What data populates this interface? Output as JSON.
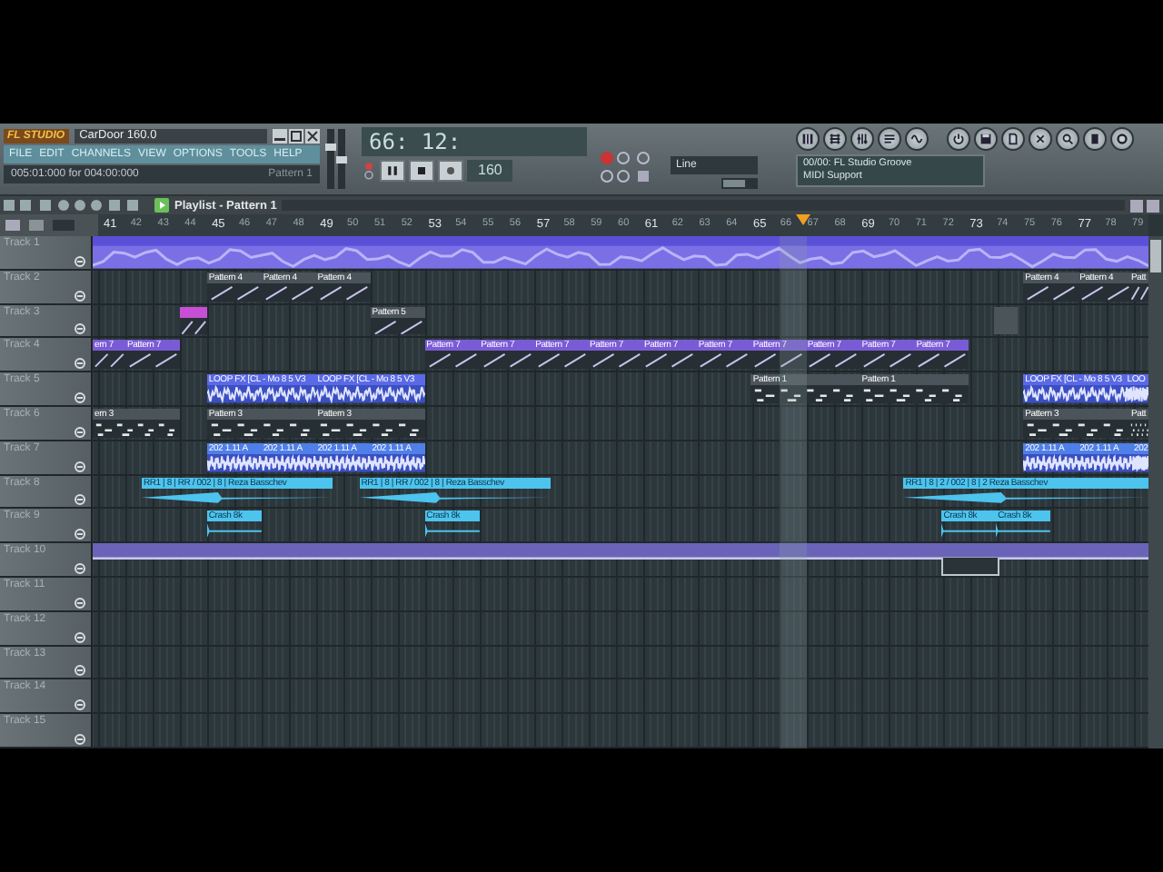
{
  "app": {
    "logo": "FL STUDIO",
    "title": "CarDoor 160.0",
    "menu": [
      "FILE",
      "EDIT",
      "CHANNELS",
      "VIEW",
      "OPTIONS",
      "TOOLS",
      "HELP"
    ],
    "hint": "005:01:000 for 004:00:000",
    "hint_pattern": "Pattern 1"
  },
  "transport": {
    "time": "66: 12:",
    "tempo": "160",
    "input": "Line",
    "volume": {
      "level": 0.75
    },
    "pitch": {
      "level": 0.5
    }
  },
  "midi": {
    "line1": "00/00: FL Studio Groove",
    "line2": "MIDI Support"
  },
  "playlist": {
    "title": "Playlist - Pattern 1",
    "bars": [
      "41",
      "42",
      "43",
      "44",
      "45",
      "46",
      "47",
      "48",
      "49",
      "50",
      "51",
      "52",
      "53",
      "54",
      "55",
      "56",
      "57",
      "58",
      "59",
      "60",
      "61",
      "62",
      "63",
      "64",
      "65",
      "66",
      "67",
      "68",
      "69",
      "70",
      "71",
      "72",
      "73",
      "74",
      "75",
      "76",
      "77",
      "78",
      "79"
    ]
  },
  "tracks": [
    {
      "name": "Track 1",
      "clips": [
        {
          "kind": "audio",
          "color": "#7b6fe6"
        }
      ]
    },
    {
      "name": "Track 2",
      "clips": [
        {
          "kind": "ramp",
          "label": "Pattern 4",
          "color": "#4b545a"
        },
        {
          "kind": "ramp",
          "label": "Pattern 4",
          "color": "#4b545a"
        },
        {
          "kind": "ramp",
          "label": "Pattern 4",
          "color": "#4b545a"
        },
        {
          "kind": "ramp",
          "label": "Pattern 4",
          "color": "#4b545a"
        },
        {
          "kind": "ramp",
          "label": "Pattern 4",
          "color": "#4b545a"
        },
        {
          "kind": "ramp",
          "label": "Patt",
          "color": "#4b545a"
        }
      ]
    },
    {
      "name": "Track 3",
      "clips": [
        {
          "kind": "ramp",
          "color": "#c64fd6"
        },
        {
          "kind": "ramp",
          "label": "Pattern 5",
          "color": "#4b545a"
        },
        {
          "kind": "stub",
          "color": "#4b545a"
        }
      ]
    },
    {
      "name": "Track 4",
      "clips": [
        {
          "kind": "ramp",
          "label": "ern 7",
          "color": "#7a5bd6"
        },
        {
          "kind": "ramp",
          "label": "Pattern 7",
          "color": "#7a5bd6"
        },
        {
          "kind": "ramp",
          "label": "Pattern 7",
          "color": "#7a5bd6"
        },
        {
          "kind": "ramp",
          "label": "Pattern 7",
          "color": "#7a5bd6"
        },
        {
          "kind": "ramp",
          "label": "Pattern 7",
          "color": "#7a5bd6"
        },
        {
          "kind": "ramp",
          "label": "Pattern 7",
          "color": "#7a5bd6"
        },
        {
          "kind": "ramp",
          "label": "Pattern 7",
          "color": "#7a5bd6"
        },
        {
          "kind": "ramp",
          "label": "Pattern 7",
          "color": "#7a5bd6"
        },
        {
          "kind": "ramp",
          "label": "Pattern 7",
          "color": "#7a5bd6"
        },
        {
          "kind": "ramp",
          "label": "Pattern 7",
          "color": "#7a5bd6"
        },
        {
          "kind": "ramp",
          "label": "Pattern 7",
          "color": "#7a5bd6"
        },
        {
          "kind": "ramp",
          "label": "Pattern 7",
          "color": "#7a5bd6"
        }
      ]
    },
    {
      "name": "Track 5",
      "clips": [
        {
          "kind": "wave",
          "label": "LOOP FX [CL - Mo 8 5 V3",
          "color": "#5a6ae6"
        },
        {
          "kind": "wave",
          "label": "LOOP FX [CL - Mo 8 5 V3",
          "color": "#5a6ae6"
        },
        {
          "kind": "steps",
          "label": "Pattern 1",
          "color": "#4b545a"
        },
        {
          "kind": "steps",
          "label": "Pattern 1",
          "color": "#4b545a"
        },
        {
          "kind": "wave",
          "label": "LOOP FX [CL - Mo 8 5 V3",
          "color": "#5a6ae6"
        },
        {
          "kind": "wave",
          "label": "LOO",
          "color": "#5a6ae6"
        }
      ]
    },
    {
      "name": "Track 6",
      "clips": [
        {
          "kind": "steps",
          "label": "ern 3",
          "color": "#4b545a"
        },
        {
          "kind": "steps",
          "label": "Pattern 3",
          "color": "#4b545a"
        },
        {
          "kind": "steps",
          "label": "Pattern 3",
          "color": "#4b545a"
        },
        {
          "kind": "steps",
          "label": "Pattern 3",
          "color": "#4b545a"
        },
        {
          "kind": "steps",
          "label": "Patt",
          "color": "#4b545a"
        }
      ]
    },
    {
      "name": "Track 7",
      "clips": [
        {
          "kind": "wave",
          "label": "202 1.11 A",
          "color": "#4f7fe8"
        },
        {
          "kind": "wave",
          "label": "202 1.11 A",
          "color": "#4f7fe8"
        },
        {
          "kind": "wave",
          "label": "202 1.11 A",
          "color": "#4f7fe8"
        },
        {
          "kind": "wave",
          "label": "202 1.11 A",
          "color": "#4f7fe8"
        },
        {
          "kind": "wave",
          "label": "202 1.11 A",
          "color": "#4f7fe8"
        },
        {
          "kind": "wave",
          "label": "202 1.11 A",
          "color": "#4f7fe8"
        },
        {
          "kind": "wave",
          "label": "202",
          "color": "#4f7fe8"
        }
      ]
    },
    {
      "name": "Track 8",
      "clips": [
        {
          "kind": "bass",
          "label": "RR1 | 8 | RR / 002 | 8 | Reza Basschev",
          "color": "#4cc4ee"
        },
        {
          "kind": "bass",
          "label": "RR1 | 8 | RR / 002 | 8 | Reza Basschev",
          "color": "#4cc4ee"
        },
        {
          "kind": "bass",
          "label": "RR1 | 8 | 2 / 002 | 8 | 2 Reza Basschev",
          "color": "#4cc4ee"
        }
      ]
    },
    {
      "name": "Track 9",
      "clips": [
        {
          "kind": "crash",
          "label": "Crash 8k",
          "color": "#4cc4ee"
        },
        {
          "kind": "crash",
          "label": "Crash 8k",
          "color": "#4cc4ee"
        },
        {
          "kind": "crash",
          "label": "Crash 8k",
          "color": "#4cc4ee"
        },
        {
          "kind": "crash",
          "label": "Crash 8k",
          "color": "#4cc4ee"
        }
      ]
    },
    {
      "name": "Track 10",
      "clips": [
        {
          "kind": "automation",
          "color": "#6a64b8"
        },
        {
          "kind": "selection"
        }
      ]
    },
    {
      "name": "Track 11"
    },
    {
      "name": "Track 12"
    },
    {
      "name": "Track 13"
    },
    {
      "name": "Track 14"
    },
    {
      "name": "Track 15"
    }
  ]
}
